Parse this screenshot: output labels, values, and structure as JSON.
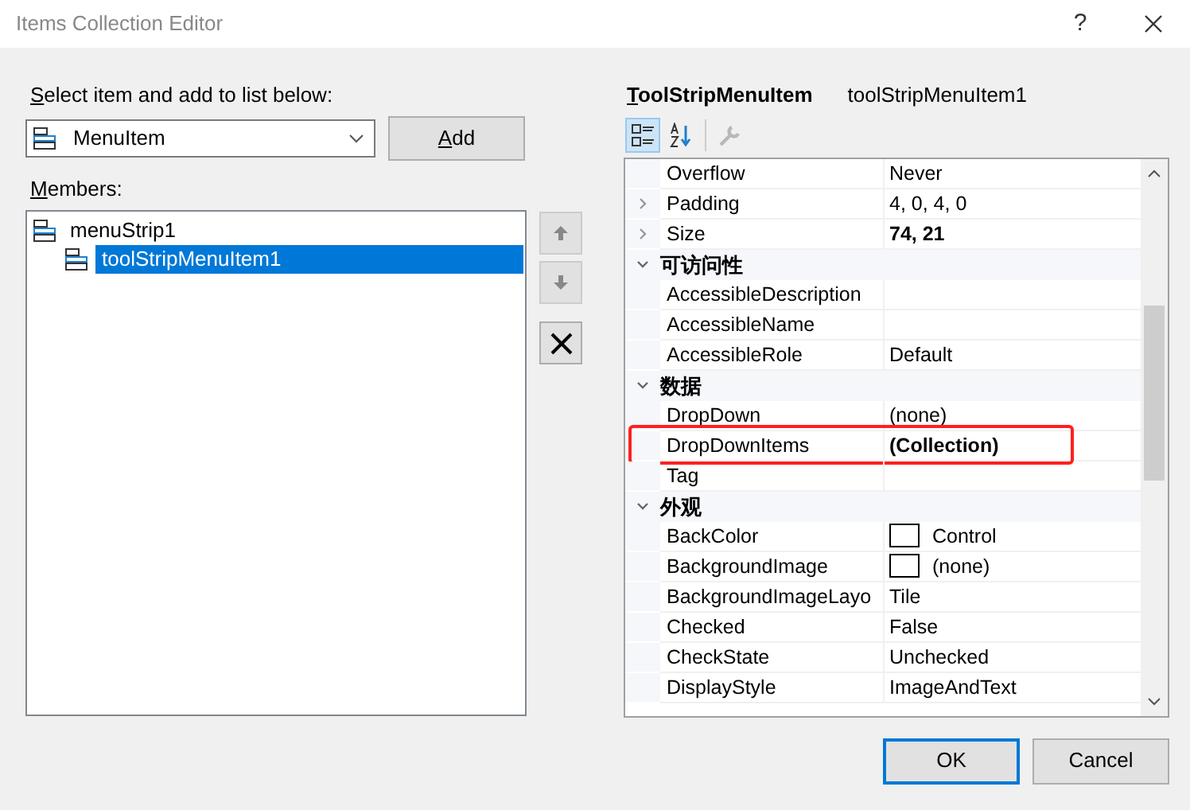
{
  "window": {
    "title": "Items Collection Editor",
    "help": "?"
  },
  "select_label": "Select item and add to list below:",
  "item_type": {
    "value": "MenuItem"
  },
  "add_button": "Add",
  "members_label": "Members:",
  "members": [
    {
      "label": "menuStrip1",
      "selected": false,
      "children": [
        {
          "label": "toolStripMenuItem1",
          "selected": true
        }
      ]
    }
  ],
  "properties_header": {
    "type": "ToolStripMenuItem",
    "name": "toolStripMenuItem1"
  },
  "toolbar": [
    {
      "kind": "categorized",
      "selected": true
    },
    {
      "kind": "alphabetical",
      "selected": false
    },
    {
      "kind": "property-pages",
      "selected": false,
      "disabled": true
    }
  ],
  "property_grid": [
    {
      "kind": "property",
      "name": "Overflow",
      "value": "Never"
    },
    {
      "kind": "property",
      "name": "Padding",
      "value": "4, 0, 4, 0",
      "expandable": true
    },
    {
      "kind": "property",
      "name": "Size",
      "value": "74, 21",
      "bold": true,
      "expandable": true
    },
    {
      "kind": "category",
      "name": "可访问性",
      "expanded": true
    },
    {
      "kind": "property",
      "name": "AccessibleDescription"
    },
    {
      "kind": "property",
      "name": "AccessibleName"
    },
    {
      "kind": "property",
      "name": "AccessibleRole",
      "value": "Default"
    },
    {
      "kind": "category",
      "name": "数据",
      "expanded": true
    },
    {
      "kind": "property",
      "name": "DropDown",
      "value": "(none)"
    },
    {
      "kind": "property",
      "name": "DropDownItems",
      "value": "(Collection)",
      "bold": true,
      "highlighted": true
    },
    {
      "kind": "property",
      "name": "Tag"
    },
    {
      "kind": "category",
      "name": "外观",
      "expanded": true
    },
    {
      "kind": "property",
      "name": "BackColor",
      "value": "Control",
      "swatch": true
    },
    {
      "kind": "property",
      "name": "BackgroundImage",
      "value": "(none)",
      "swatch": true
    },
    {
      "kind": "property",
      "name": "BackgroundImageLayo",
      "value": "Tile"
    },
    {
      "kind": "property",
      "name": "Checked",
      "value": "False"
    },
    {
      "kind": "property",
      "name": "CheckState",
      "value": "Unchecked"
    },
    {
      "kind": "property",
      "name": "DisplayStyle",
      "value": "ImageAndText"
    }
  ],
  "buttons": [
    {
      "label": "OK",
      "default": true
    },
    {
      "label": "Cancel",
      "default": false
    }
  ]
}
